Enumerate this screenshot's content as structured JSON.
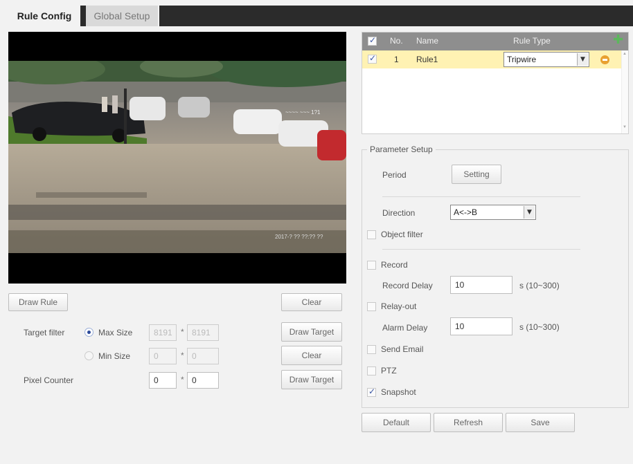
{
  "tabs": [
    {
      "label": "Rule Config",
      "active": true
    },
    {
      "label": "Global Setup",
      "active": false
    }
  ],
  "video": {
    "overlay_top": "~~~~ ~~~ 1?1",
    "overlay_bottom": "2017-? ?? ??:?? ??"
  },
  "left_controls": {
    "draw_rule": "Draw Rule",
    "clear_1": "Clear",
    "target_filter_label": "Target filter",
    "max_size_label": "Max Size",
    "max_w": "8191",
    "max_h": "8191",
    "draw_target_1": "Draw Target",
    "min_size_label": "Min Size",
    "min_w": "0",
    "min_h": "0",
    "clear_2": "Clear",
    "pixel_counter_label": "Pixel Counter",
    "pixel_w": "0",
    "pixel_h": "0",
    "draw_target_2": "Draw Target",
    "x_sep": "*"
  },
  "rule_table": {
    "headers": {
      "no": "No.",
      "name": "Name",
      "rule_type": "Rule Type"
    },
    "rows": [
      {
        "checked": true,
        "no": "1",
        "name": "Rule1",
        "rule_type": "Tripwire"
      }
    ]
  },
  "parameter_setup": {
    "title": "Parameter Setup",
    "period_label": "Period",
    "setting_button": "Setting",
    "direction_label": "Direction",
    "direction_value": "A<->B",
    "object_filter_label": "Object filter",
    "object_filter_checked": false,
    "record_label": "Record",
    "record_checked": false,
    "record_delay_label": "Record Delay",
    "record_delay_value": "10",
    "record_delay_unit": "s (10~300)",
    "relay_out_label": "Relay-out",
    "relay_out_checked": false,
    "alarm_delay_label": "Alarm Delay",
    "alarm_delay_value": "10",
    "alarm_delay_unit": "s (10~300)",
    "send_email_label": "Send Email",
    "send_email_checked": false,
    "ptz_label": "PTZ",
    "ptz_checked": false,
    "snapshot_label": "Snapshot",
    "snapshot_checked": true
  },
  "footer_buttons": {
    "default": "Default",
    "refresh": "Refresh",
    "save": "Save"
  },
  "colors": {
    "header_dark": "#2b2b2b",
    "row_selected": "#fff2b3",
    "table_header": "#8e8e8e",
    "add_icon": "#5cb85c",
    "remove_icon": "#e8a030"
  }
}
